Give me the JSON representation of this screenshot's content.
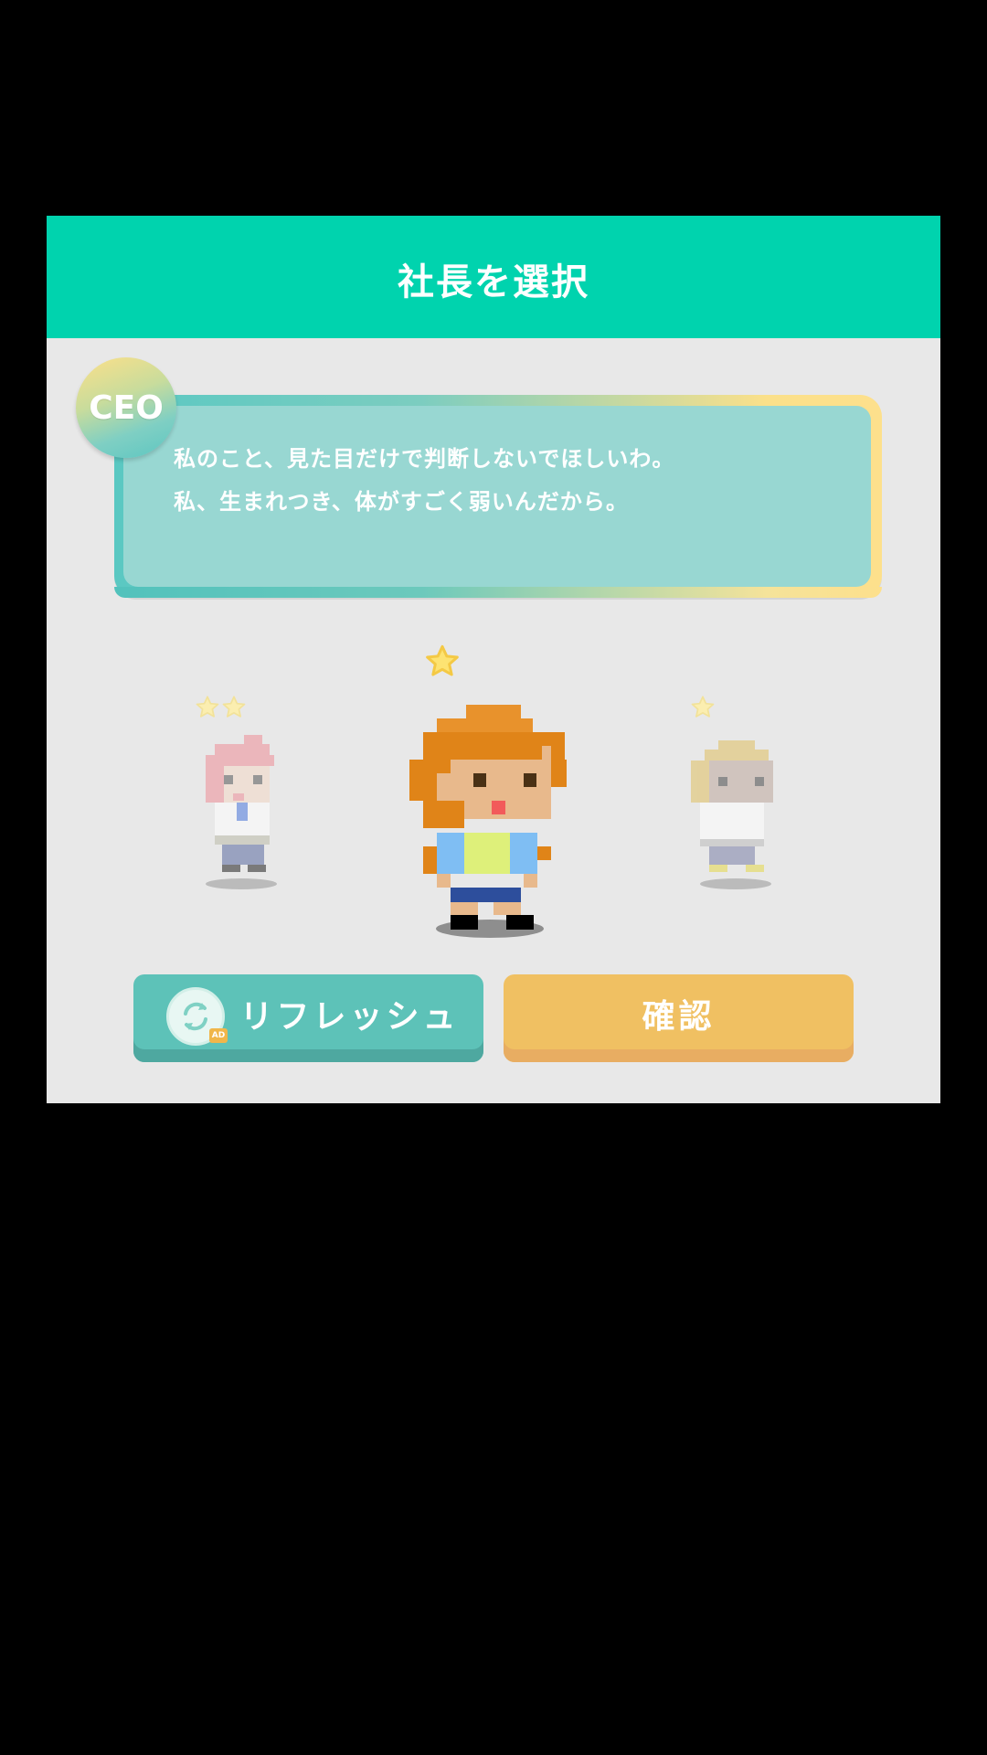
{
  "dialog": {
    "title": "社長を選択",
    "badge_label": "CEO",
    "message_lines": [
      "私のこと、見た目だけで判断しないでほしいわ。",
      "私、生まれつき、体がすごく弱いんだから。"
    ]
  },
  "characters": [
    {
      "name": "left-character",
      "stars": 2,
      "selected": false
    },
    {
      "name": "center-character",
      "stars": 1,
      "selected": true
    },
    {
      "name": "right-character",
      "stars": 1,
      "selected": false
    }
  ],
  "buttons": {
    "refresh_label": "リフレッシュ",
    "refresh_icon": "refresh-ad-icon",
    "ad_badge": "AD",
    "confirm_label": "確認"
  },
  "colors": {
    "header": "#00d3ae",
    "refresh_button": "#5dc2b8",
    "confirm_button": "#f0c062"
  }
}
